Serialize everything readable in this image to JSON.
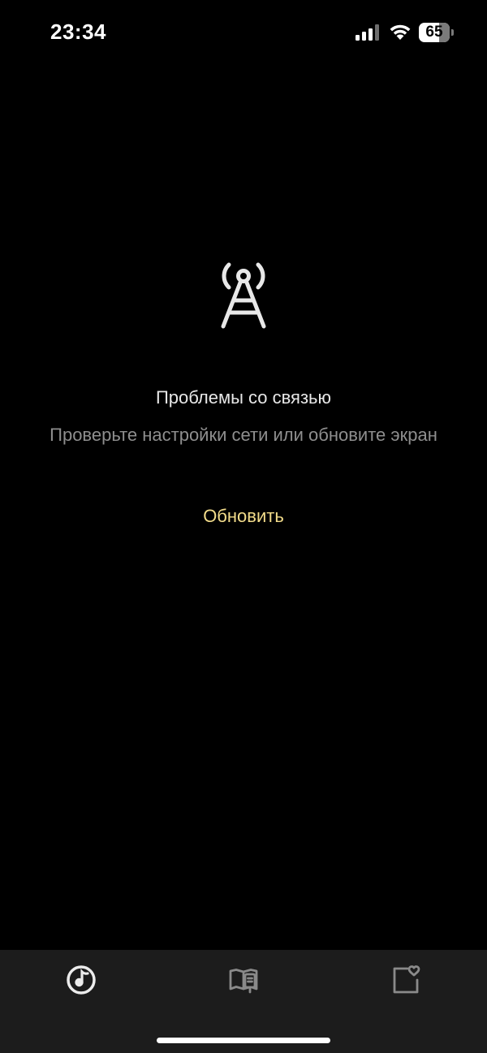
{
  "status_bar": {
    "time": "23:34",
    "battery_percent": "65",
    "battery_level": 0.65,
    "icons": [
      "signal-icon",
      "wifi-icon",
      "battery-icon"
    ]
  },
  "error": {
    "icon": "antenna-tower-icon",
    "title": "Проблемы со связью",
    "message": "Проверьте настройки сети или обновите экран",
    "refresh_label": "Обновить"
  },
  "tab_bar": {
    "tabs": [
      {
        "icon": "music-disc-icon",
        "active": true
      },
      {
        "icon": "book-library-icon",
        "active": false
      },
      {
        "icon": "heart-bookmark-icon",
        "active": false
      }
    ]
  },
  "colors": {
    "background": "#000000",
    "tab_bar": "#1c1c1c",
    "accent": "#f3dc8a",
    "secondary_text": "#8e8e8e",
    "inactive_icon": "#8a8a8a"
  }
}
